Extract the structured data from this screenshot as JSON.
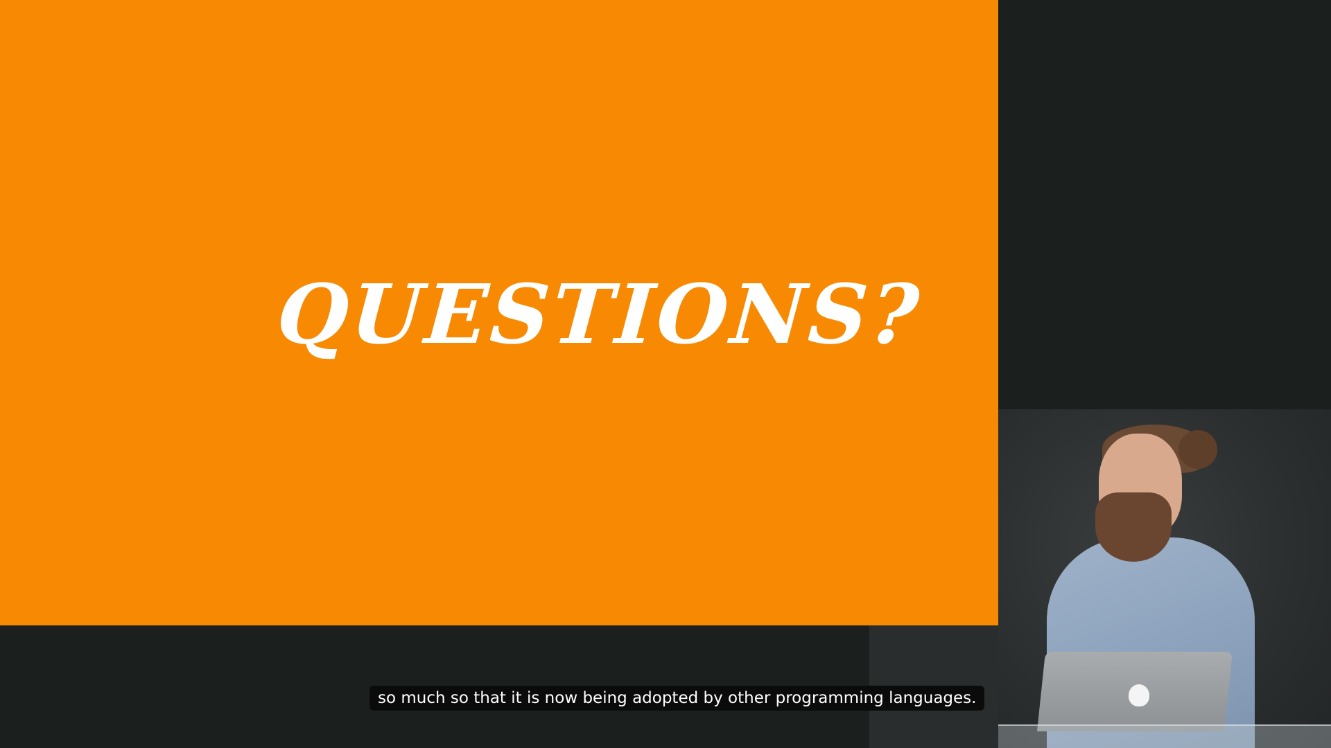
{
  "slide": {
    "title": "Questions?",
    "background_color": "#f88a03",
    "text_color": "#ffffff"
  },
  "video": {
    "caption": "so much so that it is now being adopted by other programming languages.",
    "background_color": "#1b201f"
  },
  "camera": {
    "presenter_icon": "presenter-figure",
    "laptop_logo": "apple-logo-icon"
  }
}
